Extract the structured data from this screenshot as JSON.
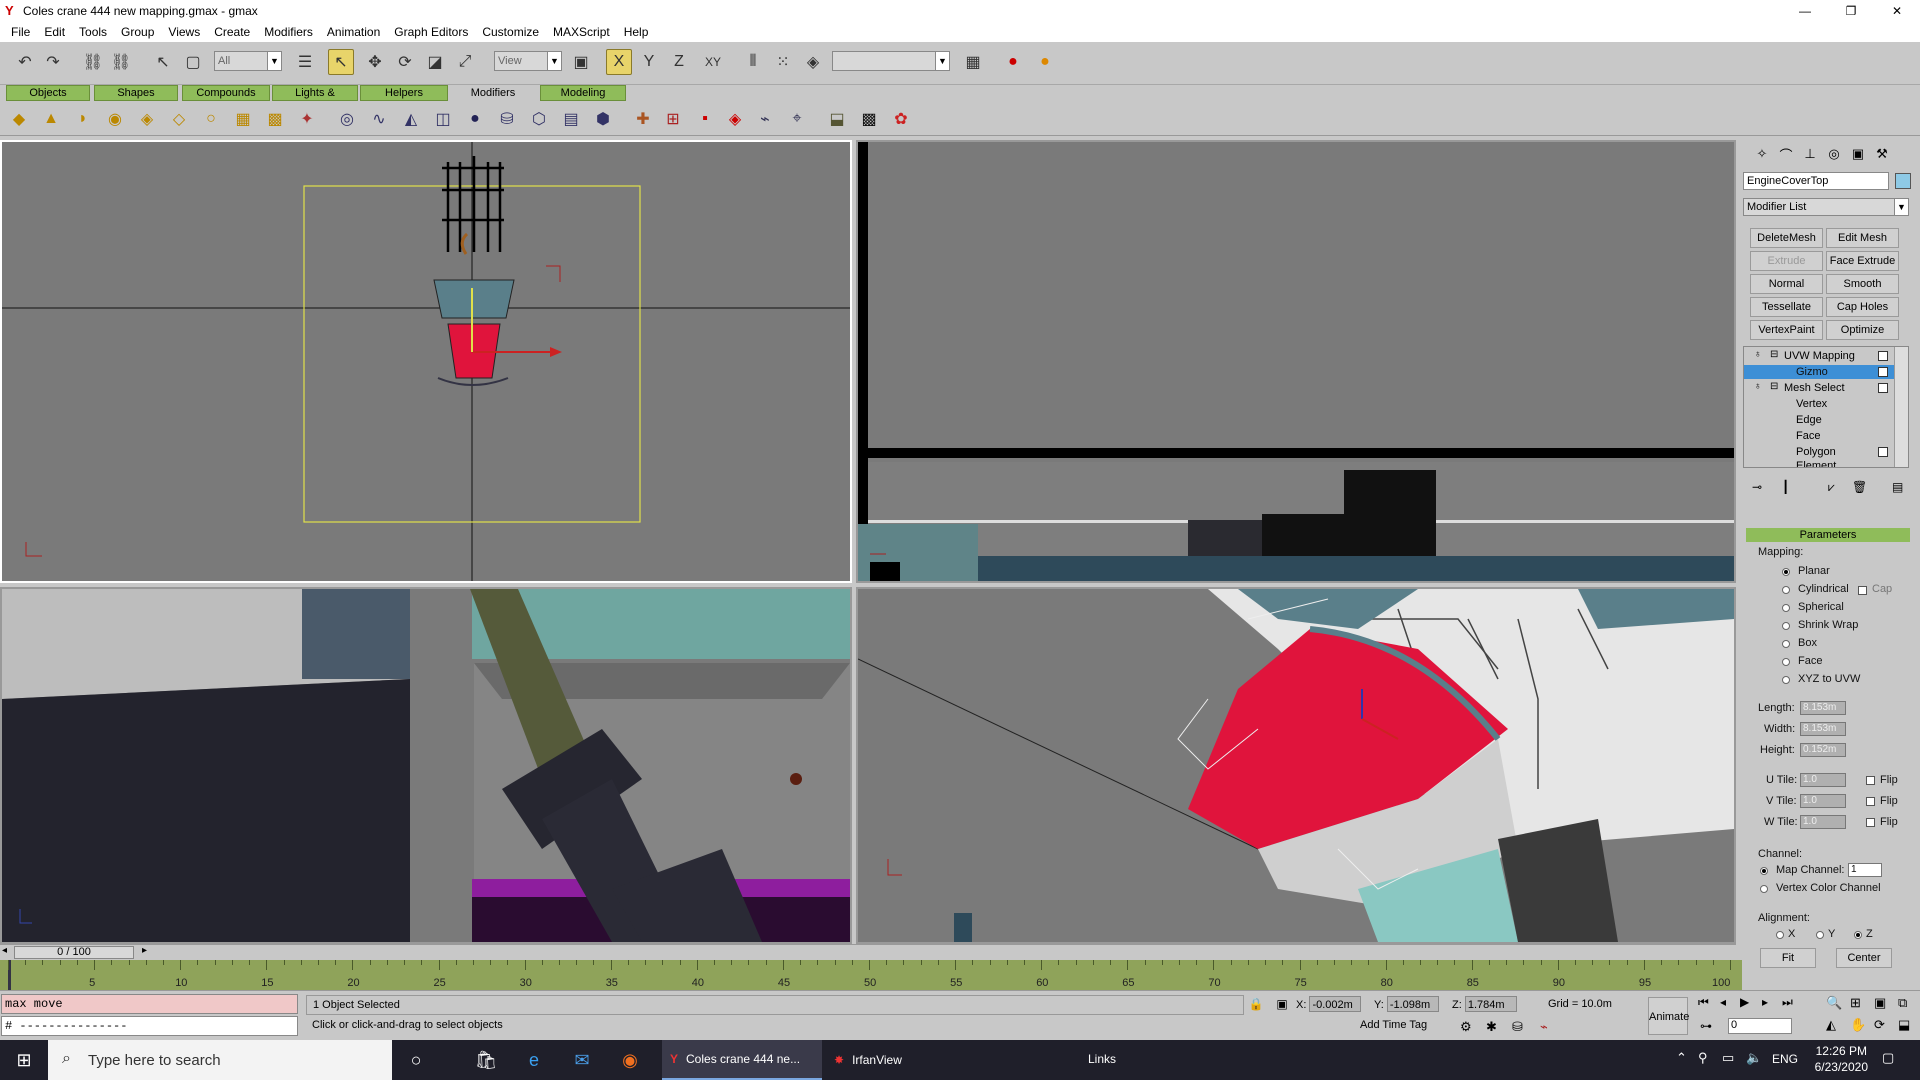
{
  "window": {
    "title": "Coles crane 444 new mapping.gmax - gmax",
    "controls": [
      "—",
      "❐",
      "✕"
    ]
  },
  "menu": [
    "File",
    "Edit",
    "Tools",
    "Group",
    "Views",
    "Create",
    "Modifiers",
    "Animation",
    "Graph Editors",
    "Customize",
    "MAXScript",
    "Help"
  ],
  "toolbar": {
    "selection_filter": "All",
    "ref_coord": "View",
    "named_sel": "",
    "axis_labels": [
      "X",
      "Y",
      "Z",
      "XY"
    ]
  },
  "tabs": [
    "Objects",
    "Shapes",
    "Compounds",
    "Lights & Cameras",
    "Helpers",
    "Modifiers",
    "Modeling"
  ],
  "command_panel": {
    "object_name": "EngineCoverTop",
    "object_color": "#8ecae6",
    "modifier_list": "Modifier List",
    "buttons": [
      {
        "label": "DeleteMesh",
        "enabled": true
      },
      {
        "label": "Edit Mesh",
        "enabled": true
      },
      {
        "label": "Extrude",
        "enabled": false
      },
      {
        "label": "Face Extrude",
        "enabled": true
      },
      {
        "label": "Normal",
        "enabled": true
      },
      {
        "label": "Smooth",
        "enabled": true
      },
      {
        "label": "Tessellate",
        "enabled": true
      },
      {
        "label": "Cap Holes",
        "enabled": true
      },
      {
        "label": "VertexPaint",
        "enabled": true
      },
      {
        "label": "Optimize",
        "enabled": true
      }
    ],
    "stack": [
      {
        "label": "UVW Mapping",
        "level": 0,
        "selected": false
      },
      {
        "label": "Gizmo",
        "level": 1,
        "selected": true
      },
      {
        "label": "Mesh Select",
        "level": 0,
        "selected": false
      },
      {
        "label": "Vertex",
        "level": 1,
        "selected": false
      },
      {
        "label": "Edge",
        "level": 1,
        "selected": false
      },
      {
        "label": "Face",
        "level": 1,
        "selected": false
      },
      {
        "label": "Polygon",
        "level": 1,
        "selected": false
      },
      {
        "label": "Element",
        "level": 1,
        "selected": false
      }
    ],
    "parameters": {
      "header": "Parameters",
      "mapping_label": "Mapping:",
      "mapping_options": [
        "Planar",
        "Cylindrical",
        "Spherical",
        "Shrink Wrap",
        "Box",
        "Face",
        "XYZ to UVW"
      ],
      "mapping_selected": "Planar",
      "cap_label": "Cap",
      "length_label": "Length:",
      "length": "8.153m",
      "width_label": "Width:",
      "width": "8.153m",
      "height_label": "Height:",
      "height": "0.152m",
      "utile_label": "U Tile:",
      "utile": "1.0",
      "vtile_label": "V Tile:",
      "vtile": "1.0",
      "wtile_label": "W Tile:",
      "wtile": "1.0",
      "flip_label": "Flip",
      "channel_label": "Channel:",
      "map_channel_label": "Map Channel:",
      "map_channel": "1",
      "vertex_color_label": "Vertex Color Channel",
      "alignment_label": "Alignment:",
      "align_axes": [
        "X",
        "Y",
        "Z"
      ],
      "fit_label": "Fit",
      "center_label": "Center"
    }
  },
  "timeline": {
    "frame": "0 / 100",
    "ticks": [
      "5",
      "10",
      "15",
      "20",
      "25",
      "30",
      "35",
      "40",
      "45",
      "50",
      "55",
      "60",
      "65",
      "70",
      "75",
      "80",
      "85",
      "90",
      "95",
      "100"
    ]
  },
  "status": {
    "maxscript_line1": "max move",
    "maxscript_line2": "# ---------------",
    "selection": "1 Object Selected",
    "prompt": "Click or click-and-drag to select objects",
    "x": "-0.002m",
    "y": "-1.098m",
    "z": "1.784m",
    "grid": "Grid = 10.0m",
    "add_time_tag": "Add Time Tag",
    "animate": "Animate",
    "frame_field": "0"
  },
  "taskbar": {
    "search_placeholder": "Type here to search",
    "apps": [
      {
        "label": "Coles crane 444 ne...",
        "active": true
      },
      {
        "label": "IrfanView",
        "active": false
      }
    ],
    "links": "Links",
    "lang": "ENG",
    "time": "12:26 PM",
    "date": "6/23/2020"
  }
}
